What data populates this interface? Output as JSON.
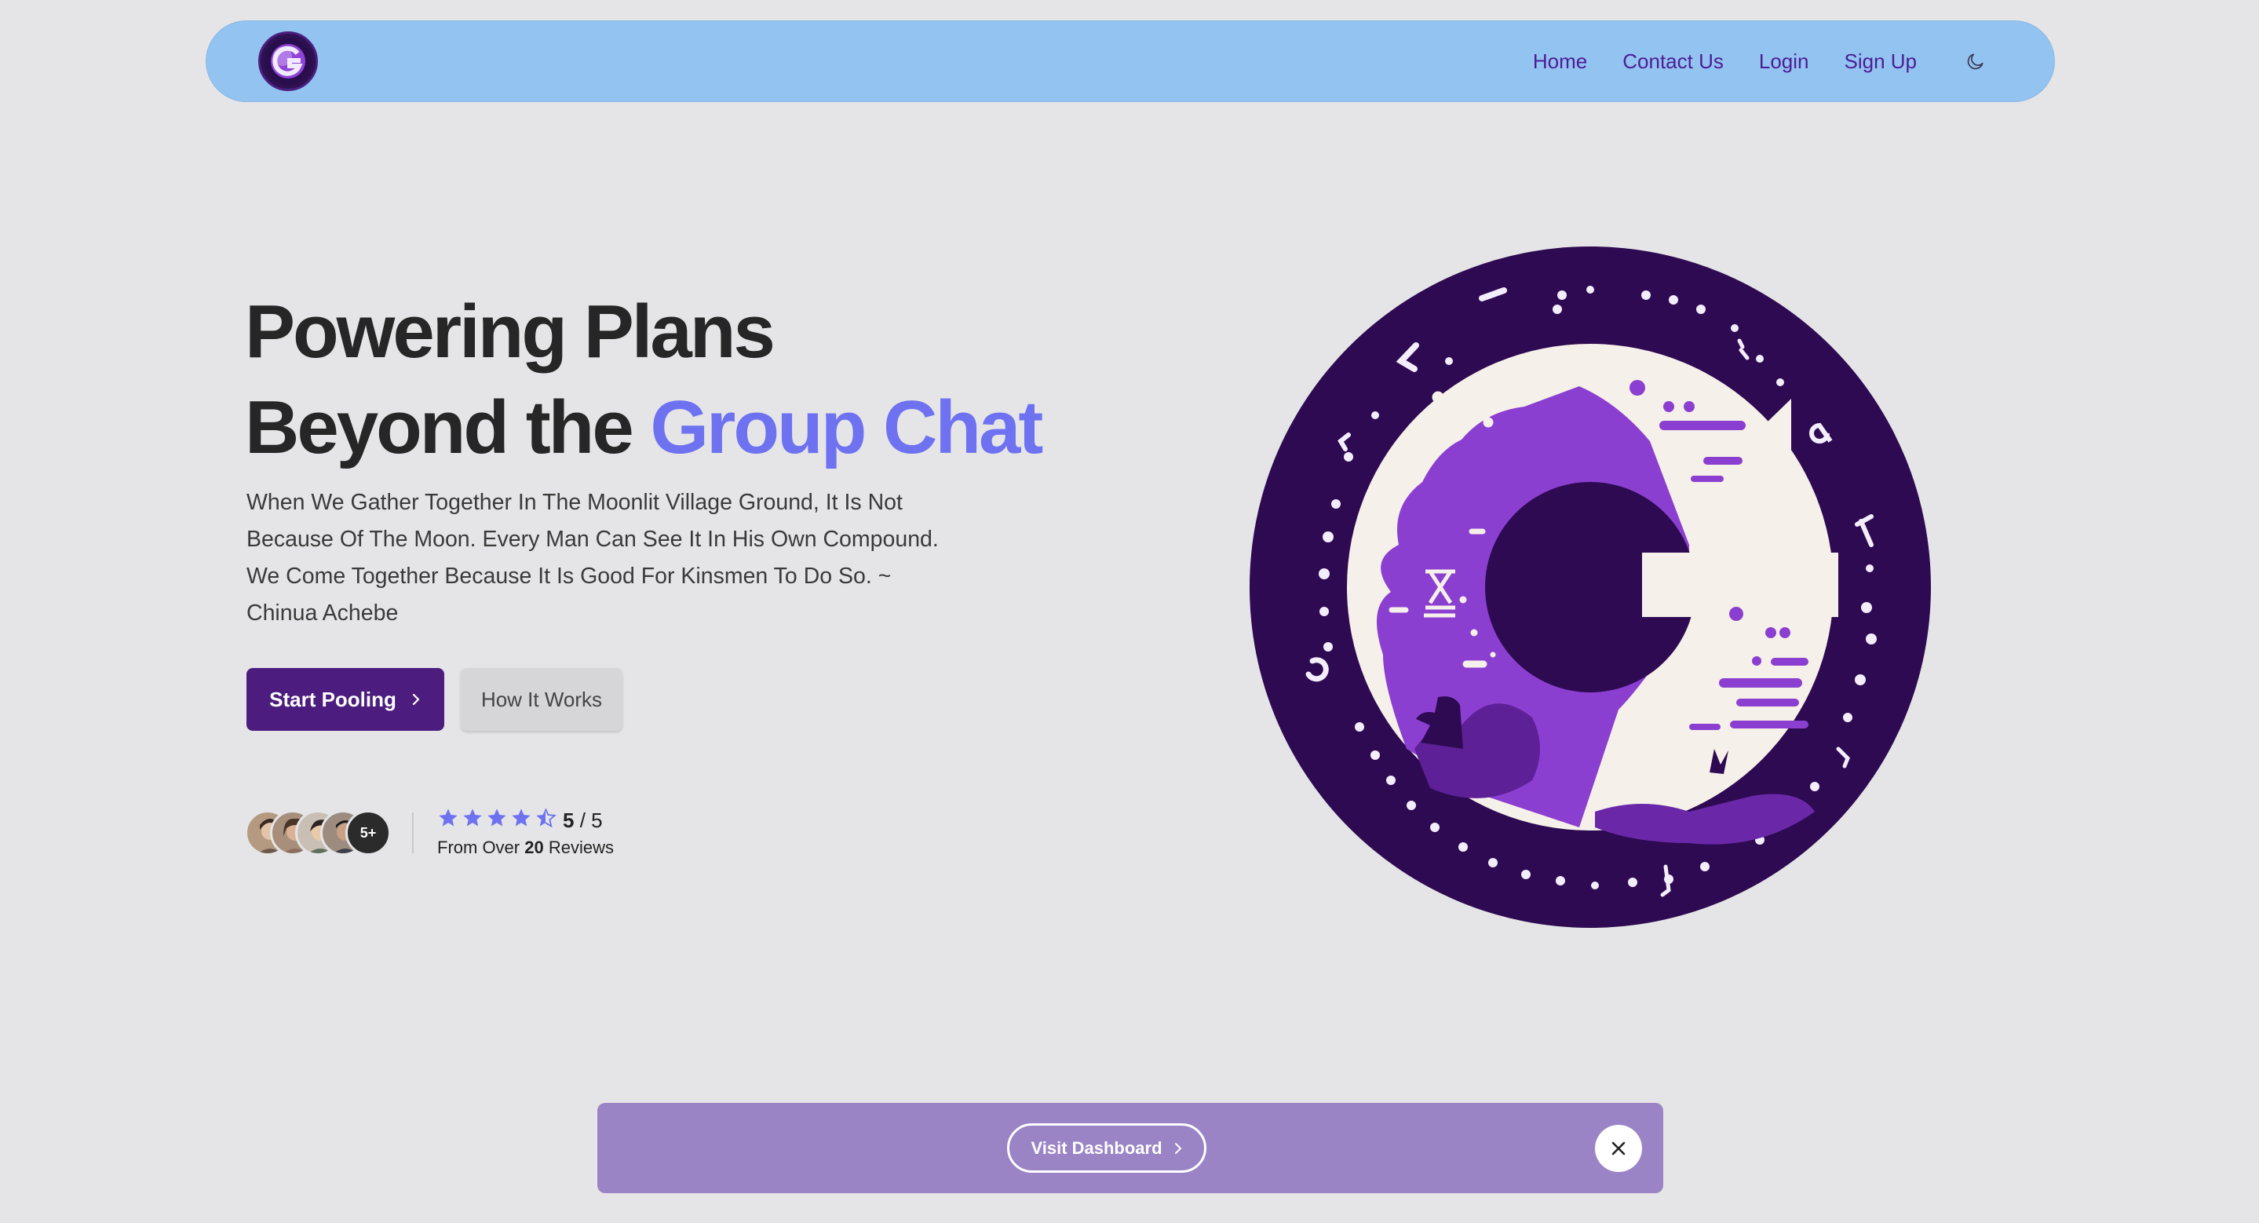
{
  "nav": {
    "links": [
      "Home",
      "Contact Us",
      "Login",
      "Sign Up"
    ],
    "logo_icon": "g-moon-logo",
    "theme_icon": "moon-icon"
  },
  "hero": {
    "title_line1": "Powering Plans",
    "title_line2_prefix": "Beyond the ",
    "title_line2_accent": "Group Chat",
    "quote": "When We Gather Together In The Moonlit Village Ground, It Is Not Because Of The Moon. Every Man Can See It In His Own Compound. We Come Together Because It Is Good For Kinsmen To Do So. ~ Chinua Achebe",
    "primary_button": "Start Pooling",
    "secondary_button": "How It Works"
  },
  "reviews": {
    "more_label": "5+",
    "rating": "5",
    "rating_suffix": " / 5",
    "stars": 4.5,
    "caption_prefix": "From Over ",
    "caption_count": "20",
    "caption_suffix": " Reviews"
  },
  "banner": {
    "button": "Visit Dashboard",
    "close_icon": "close-icon"
  },
  "colors": {
    "accent": "#6e72f0",
    "primary": "#4c1d7e",
    "nav_bg": "#93c3f0",
    "banner_bg": "#9b84c6",
    "emblem_dark": "#2e0a52",
    "emblem_purple": "#8b3fd0"
  }
}
